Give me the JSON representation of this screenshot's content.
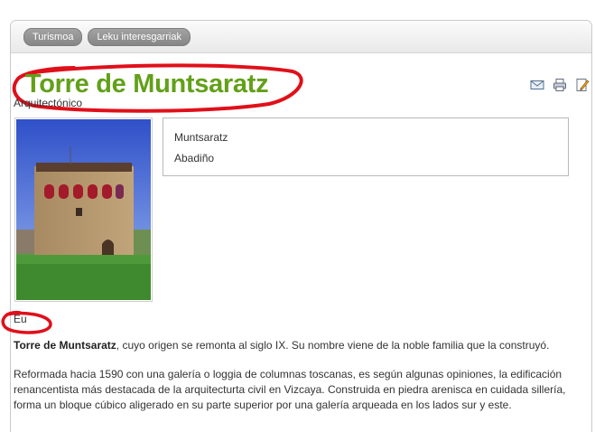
{
  "breadcrumb": [
    "Turismoa",
    "Leku interesgarriak"
  ],
  "page_title": "Torre de Muntsaratz",
  "category": "Arquitectónico",
  "info": {
    "line1": "Muntsaratz",
    "line2": "Abadiño"
  },
  "language": "Eu",
  "intro": {
    "bold": "Torre de Muntsaratz",
    "rest": ", cuyo origen se remonta al siglo IX. Su nombre viene de la noble familia que la construyó."
  },
  "paragraph2": "Reformada hacia 1590 con una galería o loggia de columnas toscanas, es según algunas opiniones, la edificación renancentista más destacada de la arquitecturta civil en Vizcaya. Construida en piedra arenisca en cuidada sillería, forma un bloque cúbico aligerado en su parte superior por una galería arqueada en los lados sur y este.",
  "tools": [
    "email-icon",
    "print-icon",
    "edit-icon"
  ],
  "colors": {
    "title": "#62a019",
    "annotation": "#e0101a",
    "pill": "#8f8f8f"
  }
}
